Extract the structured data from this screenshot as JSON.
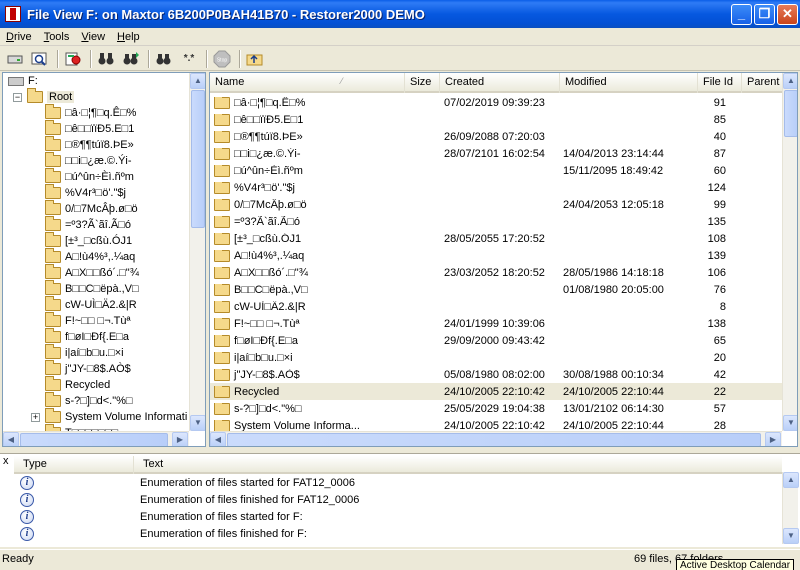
{
  "window": {
    "title": "File View F: on Maxtor  6B200P0BAH41B70 - Restorer2000 DEMO"
  },
  "menu": [
    {
      "underline": "D",
      "rest": "rive"
    },
    {
      "underline": "T",
      "rest": "ools"
    },
    {
      "underline": "V",
      "rest": "iew"
    },
    {
      "underline": "H",
      "rest": "elp"
    }
  ],
  "toolbar": [
    "drive-icon",
    "search-icon",
    "recover-icon",
    "binoculars-icon",
    "find-next-icon",
    "find-masked-icon",
    "wildcard-icon",
    "stop-icon",
    "up-folder-icon"
  ],
  "toolbar_glyphs": {
    "wildcard": "*.*",
    "stop": "Stop"
  },
  "tree": {
    "drive": "F:",
    "root": "Root",
    "items": [
      "□â·□¦¶□q.Ê□%",
      "□ê□□ïïÐ5.E□1",
      "□®¶¶túï8.ÞE»",
      "□□i□¿æ.©.Ýi-",
      "□ú^ûn÷Èì.ñºm",
      "%V4r³□ö'.\"$j",
      "0/□7McÂþ.ø□ö",
      "=º3?Ã`ãî.Ã□ó",
      "[±³_□cßù.ÓJ1",
      "A□!ù4%³,.¼aq",
      "A□X□□ßó´.□\"¾",
      "B□□C□ëpà.,V□",
      "cW-UÌ□Ä2.&|R",
      "F!~□□ □¬.Tùª",
      "f□øI□Ðf{.E□a",
      "i|aí□b□u.□×i",
      "j\"JY-□8$.AÒ$",
      "Recycled",
      "s-?□]□d<.\"%□",
      "System Volume Informati",
      "T□□□□□□□"
    ]
  },
  "list": {
    "columns": [
      "Name",
      "Size",
      "Created",
      "Modified",
      "File Id",
      "Parent I"
    ],
    "rows": [
      {
        "name": "□â·□¦¶□q.Ê□%",
        "created": "07/02/2019 09:39:23",
        "modified": "",
        "fid": "91"
      },
      {
        "name": "□ê□□ïïÐ5.E□1",
        "created": "",
        "modified": "",
        "fid": "85"
      },
      {
        "name": "□®¶¶túï8.ÞE»",
        "created": "26/09/2088 07:20:03",
        "modified": "",
        "fid": "40"
      },
      {
        "name": "□□i□¿æ.©.Ýi-",
        "created": "28/07/2101 16:02:54",
        "modified": "14/04/2013 23:14:44",
        "fid": "87"
      },
      {
        "name": "□ú^ûn÷Èì.ñºm",
        "created": "",
        "modified": "15/11/2095 18:49:42",
        "fid": "60"
      },
      {
        "name": "%V4r³□ö'.\"$j",
        "created": "",
        "modified": "",
        "fid": "124"
      },
      {
        "name": "0/□7McÂþ.ø□ö",
        "created": "",
        "modified": "24/04/2053 12:05:18",
        "fid": "99"
      },
      {
        "name": "=º3?Ã`ãî.Ã□ó",
        "created": "",
        "modified": "",
        "fid": "135"
      },
      {
        "name": "[±³_□cßù.ÓJ1",
        "created": "28/05/2055 17:20:52",
        "modified": "",
        "fid": "108"
      },
      {
        "name": "A□!ù4%³,.¼aq",
        "created": "",
        "modified": "",
        "fid": "139"
      },
      {
        "name": "A□X□□ßó´.□\"¾",
        "created": "23/03/2052 18:20:52",
        "modified": "28/05/1986 14:18:18",
        "fid": "106"
      },
      {
        "name": "B□□C□ëpà.,V□",
        "created": "",
        "modified": "01/08/1980 20:05:00",
        "fid": "76"
      },
      {
        "name": "cW-UÌ□Ä2.&|R",
        "created": "",
        "modified": "",
        "fid": "8"
      },
      {
        "name": "F!~□□ □¬.Tùª",
        "created": "24/01/1999 10:39:06",
        "modified": "",
        "fid": "138"
      },
      {
        "name": "f□øI□Ðf{.E□a",
        "created": "29/09/2000 09:43:42",
        "modified": "",
        "fid": "65"
      },
      {
        "name": "i|aí□b□u.□×i",
        "created": "",
        "modified": "",
        "fid": "20"
      },
      {
        "name": "j\"JY-□8$.AÒ$",
        "created": "05/08/1980 08:02:00",
        "modified": "30/08/1988 00:10:34",
        "fid": "42"
      },
      {
        "name": "Recycled",
        "created": "24/10/2005 22:10:42",
        "modified": "24/10/2005 22:10:44",
        "fid": "22"
      },
      {
        "name": "s-?□]□d<.\"%□",
        "created": "25/05/2029 19:04:38",
        "modified": "13/01/2102 06:14:30",
        "fid": "57"
      },
      {
        "name": "System Volume Informa...",
        "created": "24/10/2005 22:10:42",
        "modified": "24/10/2005 22:10:44",
        "fid": "28"
      }
    ]
  },
  "log": {
    "close": "x",
    "columns": [
      "Type",
      "Text"
    ],
    "rows": [
      "Enumeration of files started for FAT12_0006",
      "Enumeration of files finished for FAT12_0006",
      "Enumeration of files started for F:",
      "Enumeration of files finished for F:"
    ]
  },
  "status": {
    "ready": "Ready",
    "count": "69 files, 67 folders"
  },
  "tooltip": "Active Desktop Calendar",
  "colors": {
    "titlebar": "#0658E0",
    "selection": "#ECE9D8",
    "folder": "#F5D98B"
  }
}
